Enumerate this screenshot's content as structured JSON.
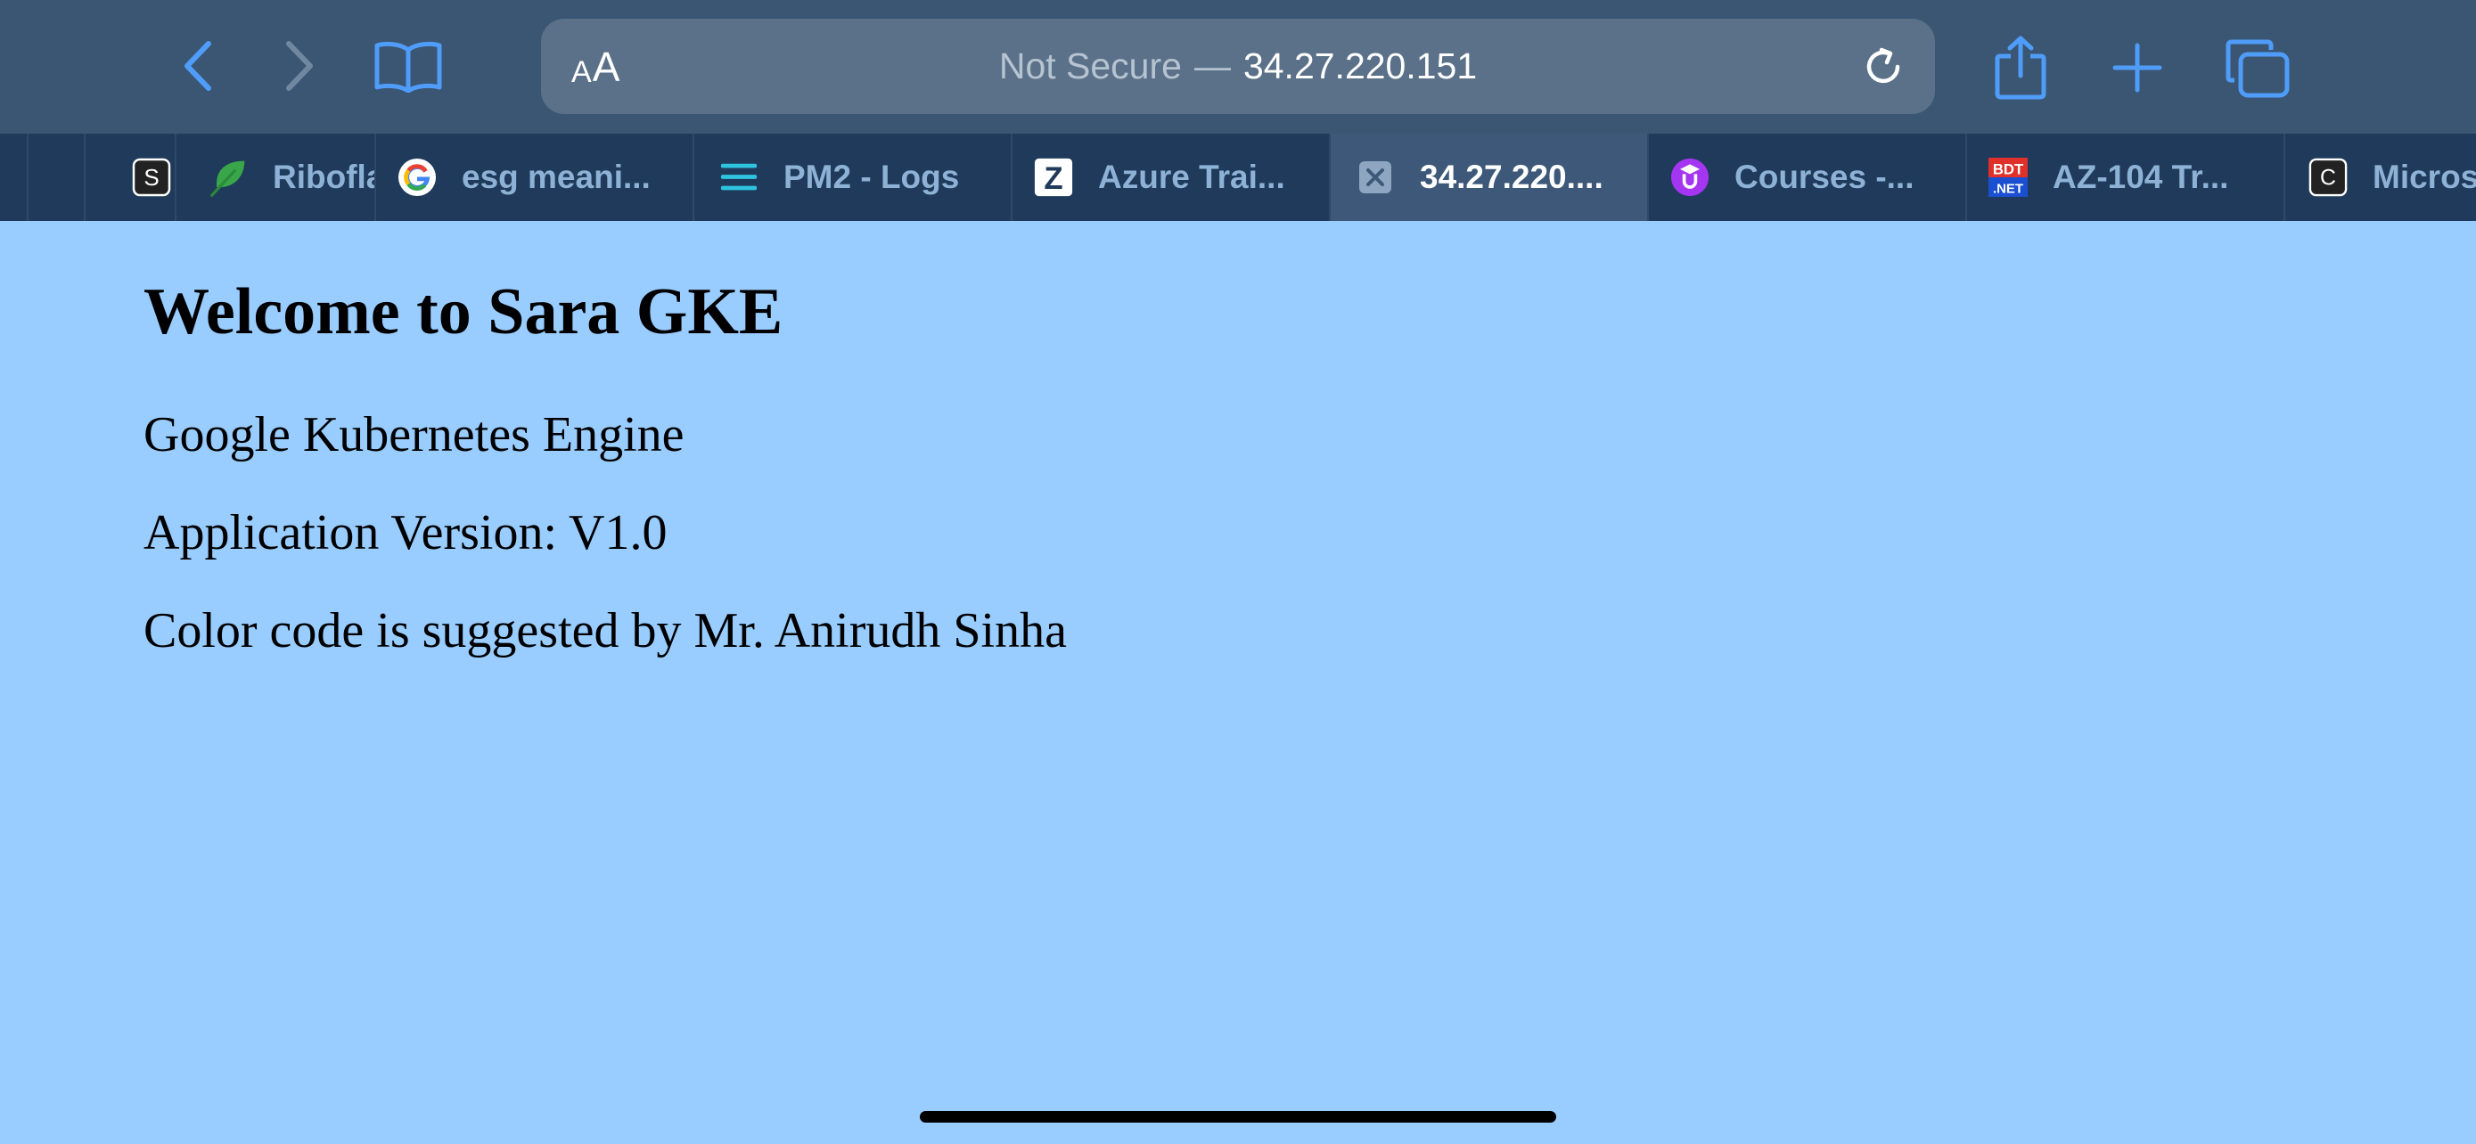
{
  "toolbar": {
    "back_icon": "chevron-left-icon",
    "forward_icon": "chevron-right-icon",
    "bookmarks_icon": "book-icon",
    "share_icon": "share-icon",
    "new_tab_icon": "plus-icon",
    "tabs_overview_icon": "tabs-icon",
    "accent_color": "#4f9cf9",
    "disabled_color": "#6f879f"
  },
  "address_bar": {
    "aa_small": "A",
    "aa_big": "A",
    "security_label": "Not Secure",
    "separator": "—",
    "host": "34.27.220.151",
    "reload_icon": "reload-icon"
  },
  "tabs": [
    {
      "label": "",
      "icon_letter": "",
      "active": false
    },
    {
      "label": "",
      "icon_letter": "S",
      "icon": "s-square-icon",
      "active": false
    },
    {
      "label": "Ribofla",
      "icon": "leaf-icon",
      "active": false
    },
    {
      "label": "esg meani...",
      "icon": "google-icon",
      "active": false
    },
    {
      "label": "PM2 - Logs",
      "icon": "lines-icon",
      "active": false
    },
    {
      "label": "Azure Trai...",
      "icon_letter": "Z",
      "icon": "z-square-icon",
      "active": false
    },
    {
      "label": "34.27.220....",
      "icon": "close-icon",
      "active": true
    },
    {
      "label": "Courses -...",
      "icon": "udemy-icon",
      "active": false
    },
    {
      "label": "AZ-104 Tr...",
      "icon_top": "BDT",
      "icon_bottom": ".NET",
      "icon": "bdt-net-icon",
      "active": false
    },
    {
      "label": "Micros",
      "icon_letter": "C",
      "icon": "c-square-icon",
      "active": false
    }
  ],
  "page": {
    "heading": "Welcome to Sara GKE",
    "line1": "Google Kubernetes Engine",
    "line2": "Application Version: V1.0",
    "line3": "Color code is suggested by Mr. Anirudh Sinha",
    "background_color": "#99ccff"
  }
}
